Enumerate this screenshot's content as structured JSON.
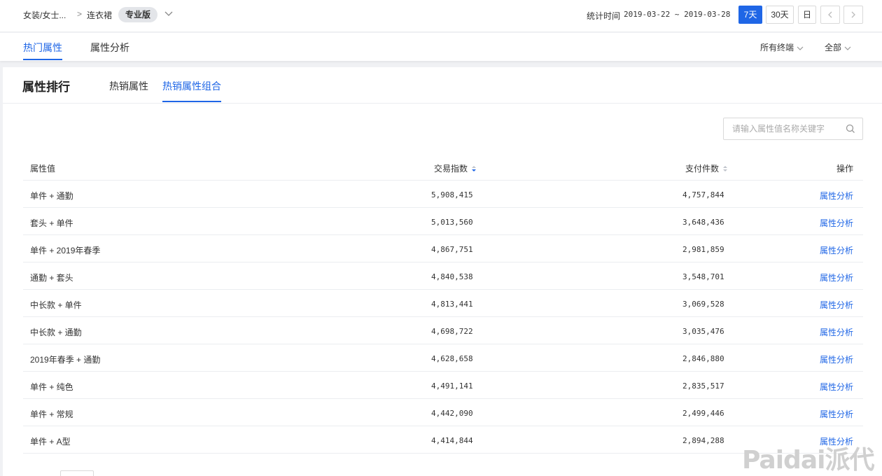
{
  "breadcrumb": {
    "path": "女装/女士...",
    "category": "连衣裙",
    "edition": "专业版"
  },
  "stats": {
    "label": "统计时间",
    "range": "2019-03-22 ~ 2019-03-28"
  },
  "date_buttons": {
    "d7": "7天",
    "d30": "30天",
    "day": "日"
  },
  "subnav": {
    "tabs": [
      "热门属性",
      "属性分析"
    ],
    "filters": [
      "所有终端",
      "全部"
    ]
  },
  "panel": {
    "title": "属性排行",
    "tabs": [
      "热销属性",
      "热销属性组合"
    ],
    "search_placeholder": "请输入属性值名称关键字"
  },
  "table": {
    "headers": {
      "attr": "属性值",
      "trade": "交易指数",
      "paid": "支付件数",
      "op": "操作"
    },
    "action_label": "属性分析",
    "rows": [
      {
        "attr": "单件 + 通勤",
        "trade": "5,908,415",
        "paid": "4,757,844"
      },
      {
        "attr": "套头 + 单件",
        "trade": "5,013,560",
        "paid": "3,648,436"
      },
      {
        "attr": "单件 + 2019年春季",
        "trade": "4,867,751",
        "paid": "2,981,859"
      },
      {
        "attr": "通勤 + 套头",
        "trade": "4,840,538",
        "paid": "3,548,701"
      },
      {
        "attr": "中长款 + 单件",
        "trade": "4,813,441",
        "paid": "3,069,528"
      },
      {
        "attr": "中长款 + 通勤",
        "trade": "4,698,722",
        "paid": "3,035,476"
      },
      {
        "attr": "2019年春季 + 通勤",
        "trade": "4,628,658",
        "paid": "2,846,880"
      },
      {
        "attr": "单件 + 纯色",
        "trade": "4,491,141",
        "paid": "2,835,517"
      },
      {
        "attr": "单件 + 常规",
        "trade": "4,442,090",
        "paid": "2,499,446"
      },
      {
        "attr": "单件 + A型",
        "trade": "4,414,844",
        "paid": "2,894,288"
      }
    ]
  },
  "watermark": "Paidai派代",
  "colors": {
    "accent": "#1f66e6",
    "border": "#ebedf0",
    "bg": "#f0f1f4"
  }
}
